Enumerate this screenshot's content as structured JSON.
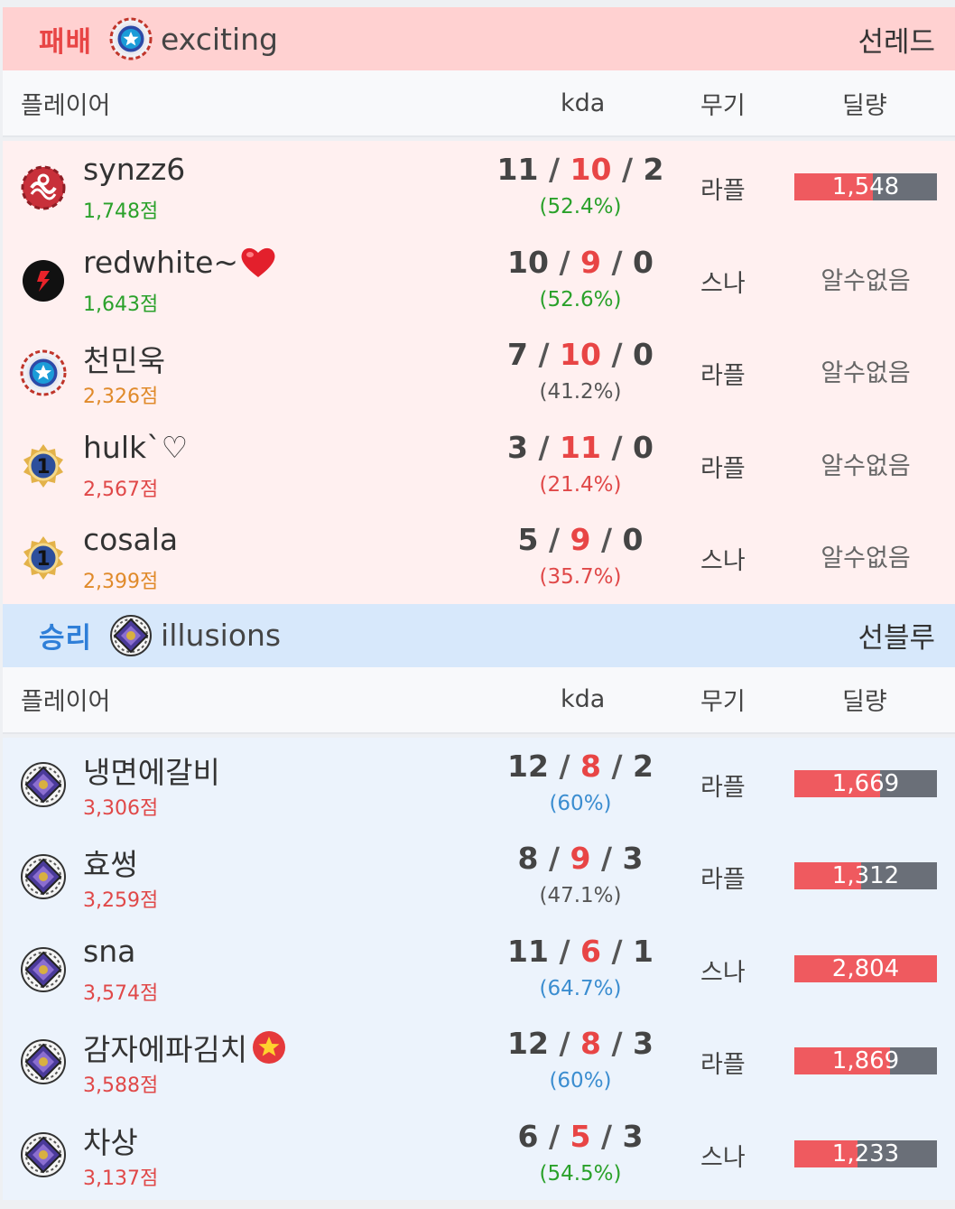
{
  "teams": [
    {
      "result": "패배",
      "name": "exciting",
      "side": "선레드",
      "columns": {
        "player": "플레이어",
        "kda": "kda",
        "weapon": "무기",
        "damage": "딜량"
      },
      "players": [
        {
          "name": "synzz6",
          "score": "1,748점",
          "kills": "11",
          "deaths": "10",
          "assists": "2",
          "kp": "(52.4%)",
          "weapon": "라플",
          "damage": "1,548",
          "damage_fraction": 0.55
        },
        {
          "name": "redwhite~",
          "score": "1,643점",
          "kills": "10",
          "deaths": "9",
          "assists": "0",
          "kp": "(52.6%)",
          "weapon": "스나",
          "damage": "알수없음"
        },
        {
          "name": "천민욱",
          "score": "2,326점",
          "kills": "7",
          "deaths": "10",
          "assists": "0",
          "kp": "(41.2%)",
          "weapon": "라플",
          "damage": "알수없음"
        },
        {
          "name": "hulk`♡",
          "score": "2,567점",
          "kills": "3",
          "deaths": "11",
          "assists": "0",
          "kp": "(21.4%)",
          "weapon": "라플",
          "damage": "알수없음"
        },
        {
          "name": "cosala",
          "score": "2,399점",
          "kills": "5",
          "deaths": "9",
          "assists": "0",
          "kp": "(35.7%)",
          "weapon": "스나",
          "damage": "알수없음"
        }
      ]
    },
    {
      "result": "승리",
      "name": "illusions",
      "side": "선블루",
      "columns": {
        "player": "플레이어",
        "kda": "kda",
        "weapon": "무기",
        "damage": "딜량"
      },
      "players": [
        {
          "name": "냉면에갈비",
          "score": "3,306점",
          "kills": "12",
          "deaths": "8",
          "assists": "2",
          "kp": "(60%)",
          "weapon": "라플",
          "damage": "1,669",
          "damage_fraction": 0.6
        },
        {
          "name": "효썽",
          "score": "3,259점",
          "kills": "8",
          "deaths": "9",
          "assists": "3",
          "kp": "(47.1%)",
          "weapon": "라플",
          "damage": "1,312",
          "damage_fraction": 0.47
        },
        {
          "name": "sna",
          "score": "3,574점",
          "kills": "11",
          "deaths": "6",
          "assists": "1",
          "kp": "(64.7%)",
          "weapon": "스나",
          "damage": "2,804",
          "damage_fraction": 1.0
        },
        {
          "name": "감자에파김치",
          "score": "3,588점",
          "kills": "12",
          "deaths": "8",
          "assists": "3",
          "kp": "(60%)",
          "weapon": "라플",
          "damage": "1,869",
          "damage_fraction": 0.67
        },
        {
          "name": "차상",
          "score": "3,137점",
          "kills": "6",
          "deaths": "5",
          "assists": "3",
          "kp": "(54.5%)",
          "weapon": "스나",
          "damage": "1,233",
          "damage_fraction": 0.44
        }
      ]
    }
  ],
  "colors": {
    "lose_header": "#ffd1d1",
    "win_header": "#d7e8fb",
    "lose_rows": "#fff0f0",
    "win_rows": "#ecf3fc",
    "death_red": "#e84545",
    "bar_fill": "#ef5a5f",
    "bar_bg": "#6a6f78"
  },
  "icons": {
    "exciting_emblem": "star-shield-emblem-icon",
    "illusions_emblem": "diamond-emblem-icon",
    "heart": "heart-icon",
    "star_badge": "star-badge-icon"
  }
}
